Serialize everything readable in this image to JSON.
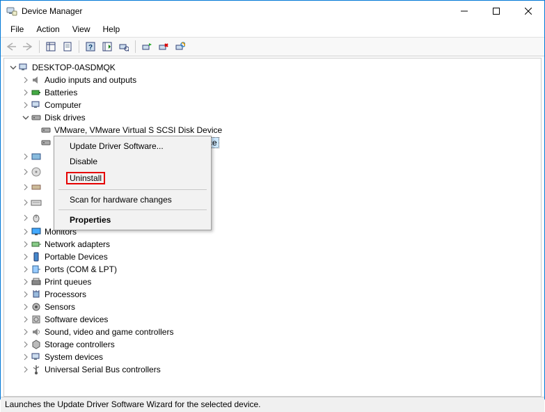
{
  "window": {
    "title": "Device Manager"
  },
  "menubar": {
    "file": "File",
    "action": "Action",
    "view": "View",
    "help": "Help"
  },
  "tree": {
    "root": "DESKTOP-0ASDMQK",
    "cat_audio": "Audio inputs and outputs",
    "cat_batteries": "Batteries",
    "cat_computer": "Computer",
    "cat_disk": "Disk drives",
    "disk_item1": "VMware, VMware Virtual S SCSI Disk Device",
    "disk_item2_tail": "ce",
    "cat_monitors": "Monitors",
    "cat_network": "Network adapters",
    "cat_portable": "Portable Devices",
    "cat_ports": "Ports (COM & LPT)",
    "cat_print": "Print queues",
    "cat_processors": "Processors",
    "cat_sensors": "Sensors",
    "cat_software": "Software devices",
    "cat_sound": "Sound, video and game controllers",
    "cat_storage": "Storage controllers",
    "cat_system": "System devices",
    "cat_usb": "Universal Serial Bus controllers"
  },
  "context_menu": {
    "update": "Update Driver Software...",
    "disable": "Disable",
    "uninstall": "Uninstall",
    "scan": "Scan for hardware changes",
    "properties": "Properties"
  },
  "statusbar": {
    "text": "Launches the Update Driver Software Wizard for the selected device."
  }
}
